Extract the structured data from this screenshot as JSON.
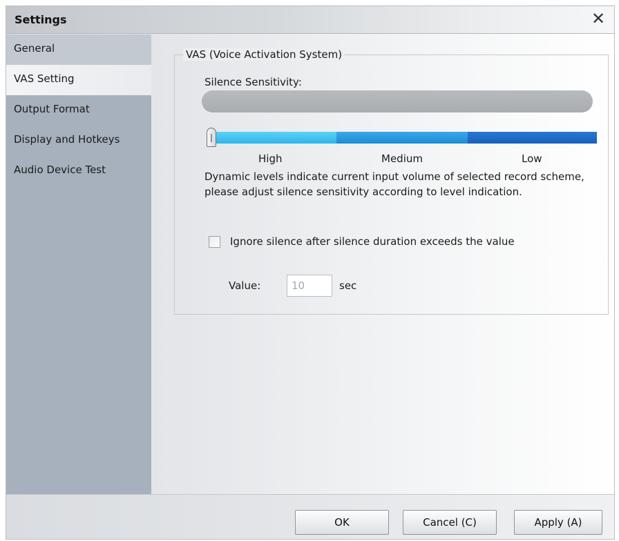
{
  "window": {
    "title": "Settings",
    "close_glyph": "✕"
  },
  "sidebar": {
    "items": [
      {
        "label": "General"
      },
      {
        "label": "VAS Setting"
      },
      {
        "label": "Output Format"
      },
      {
        "label": "Display and Hotkeys"
      },
      {
        "label": "Audio Device Test"
      }
    ],
    "selected": "VAS Setting"
  },
  "vas": {
    "group_title": "VAS (Voice Activation System)",
    "sensitivity_label": "Silence Sensitivity:",
    "level_labels": {
      "high": "High",
      "medium": "Medium",
      "low": "Low"
    },
    "slider_value": 0,
    "description": "Dynamic levels indicate current input volume of selected record scheme, please adjust silence sensitivity according to level indication.",
    "ignore_checkbox_label": "Ignore silence after silence duration exceeds the value",
    "ignore_checked": false,
    "value_label": "Value:",
    "value": "10",
    "value_unit": "sec"
  },
  "footer": {
    "ok_label": "OK",
    "cancel_label": "Cancel (C)",
    "apply_label": "Apply (A)"
  },
  "colors": {
    "sidebar_bg": "#a7b1bd",
    "seg_high": "#3ec3f0",
    "seg_medium": "#2a96dd",
    "seg_low": "#1c6cc6"
  },
  "icons": {
    "close": "close-icon"
  }
}
